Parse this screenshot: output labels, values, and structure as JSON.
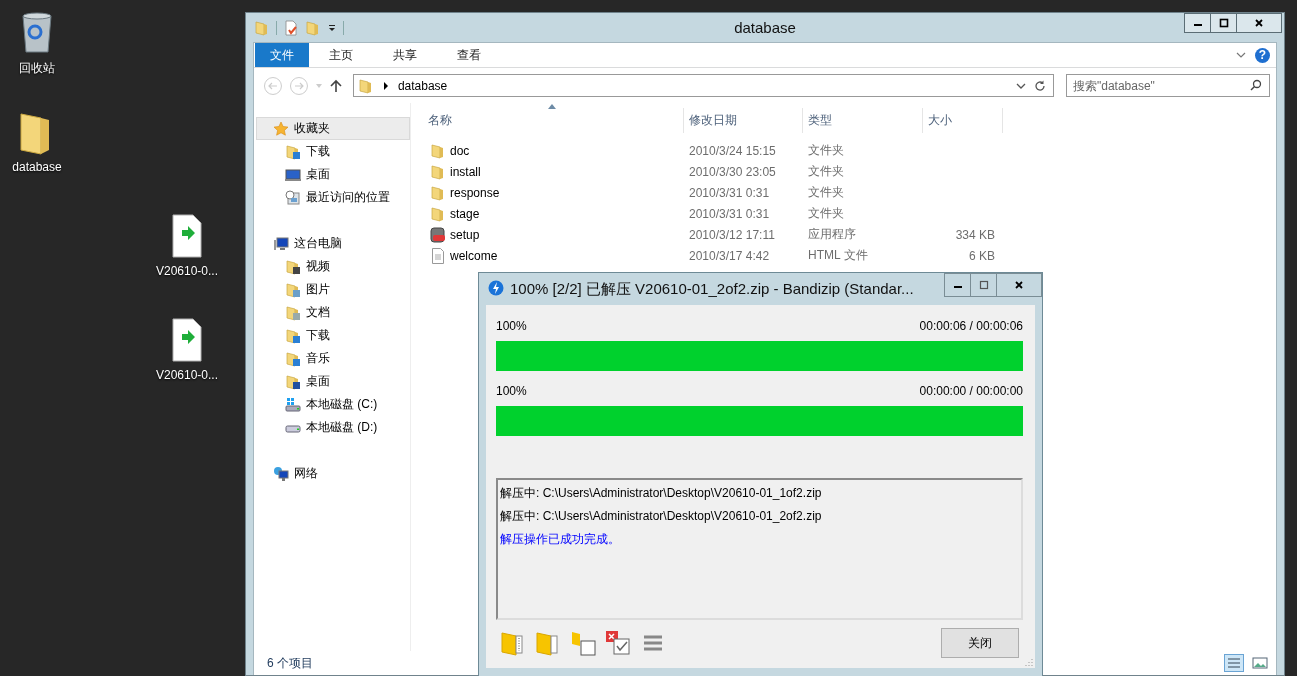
{
  "desktop": {
    "icons": [
      {
        "kind": "recycle-bin",
        "label": "回收站"
      },
      {
        "kind": "folder",
        "label": "database"
      },
      {
        "kind": "archive",
        "label": "V20610-0..."
      },
      {
        "kind": "archive",
        "label": "V20610-0..."
      }
    ]
  },
  "explorer": {
    "title": "database",
    "ribbon_tabs": [
      {
        "label": "文件",
        "selected": true
      },
      {
        "label": "主页",
        "selected": false
      },
      {
        "label": "共享",
        "selected": false
      },
      {
        "label": "查看",
        "selected": false
      }
    ],
    "help_glyph": "?",
    "address": {
      "path": "database"
    },
    "search": {
      "placeholder": "搜索\"database\""
    },
    "nav": [
      {
        "label": "收藏夹",
        "kind": "favorites",
        "selected": true,
        "children": [
          {
            "label": "下载",
            "kind": "downloads",
            "selected": false
          },
          {
            "label": "桌面",
            "kind": "desktop",
            "selected": false
          },
          {
            "label": "最近访问的位置",
            "kind": "recent",
            "selected": false
          }
        ]
      },
      {
        "label": "这台电脑",
        "kind": "computer",
        "selected": false,
        "children": [
          {
            "label": "视频",
            "kind": "videos",
            "selected": false
          },
          {
            "label": "图片",
            "kind": "pictures",
            "selected": false
          },
          {
            "label": "文档",
            "kind": "documents",
            "selected": false
          },
          {
            "label": "下载",
            "kind": "downloads",
            "selected": false
          },
          {
            "label": "音乐",
            "kind": "music",
            "selected": false
          },
          {
            "label": "桌面",
            "kind": "desktop-folder",
            "selected": false
          },
          {
            "label": "本地磁盘 (C:)",
            "kind": "system-drive",
            "selected": false
          },
          {
            "label": "本地磁盘 (D:)",
            "kind": "drive",
            "selected": false
          }
        ]
      },
      {
        "label": "网络",
        "kind": "network",
        "selected": false
      }
    ],
    "columns": [
      "名称",
      "修改日期",
      "类型",
      "大小"
    ],
    "files": [
      {
        "kind": "folder",
        "name": "doc",
        "modified": "2010/3/24 15:15",
        "type": "文件夹"
      },
      {
        "kind": "folder",
        "name": "install",
        "modified": "2010/3/30 23:05",
        "type": "文件夹"
      },
      {
        "kind": "folder",
        "name": "response",
        "modified": "2010/3/31 0:31",
        "type": "文件夹"
      },
      {
        "kind": "folder",
        "name": "stage",
        "modified": "2010/3/31 0:31",
        "type": "文件夹"
      },
      {
        "kind": "application",
        "name": "setup",
        "modified": "2010/3/12 17:11",
        "type": "应用程序",
        "size": "334 KB"
      },
      {
        "kind": "html",
        "name": "welcome",
        "modified": "2010/3/17 4:42",
        "type": "HTML 文件",
        "size": "6 KB"
      }
    ],
    "status_bar": {
      "item_count": "6 个项目"
    }
  },
  "bandizip": {
    "title": "100% [2/2] 已解压 V20610-01_2of2.zip - Bandizip (Standar...",
    "progress": [
      {
        "percent": "100%",
        "time": "00:00:06 / 00:00:06",
        "level": 1
      },
      {
        "percent": "100%",
        "time": "00:00:00 / 00:00:00",
        "level": 1
      }
    ],
    "log": [
      {
        "kind": "progress",
        "text": "解压中: C:\\Users\\Administrator\\Desktop\\V20610-01_1of2.zip"
      },
      {
        "kind": "progress",
        "text": "解压中: C:\\Users\\Administrator\\Desktop\\V20610-01_2of2.zip"
      },
      {
        "kind": "result",
        "text": "解压操作已成功完成。"
      }
    ],
    "close_button": "关闭"
  }
}
